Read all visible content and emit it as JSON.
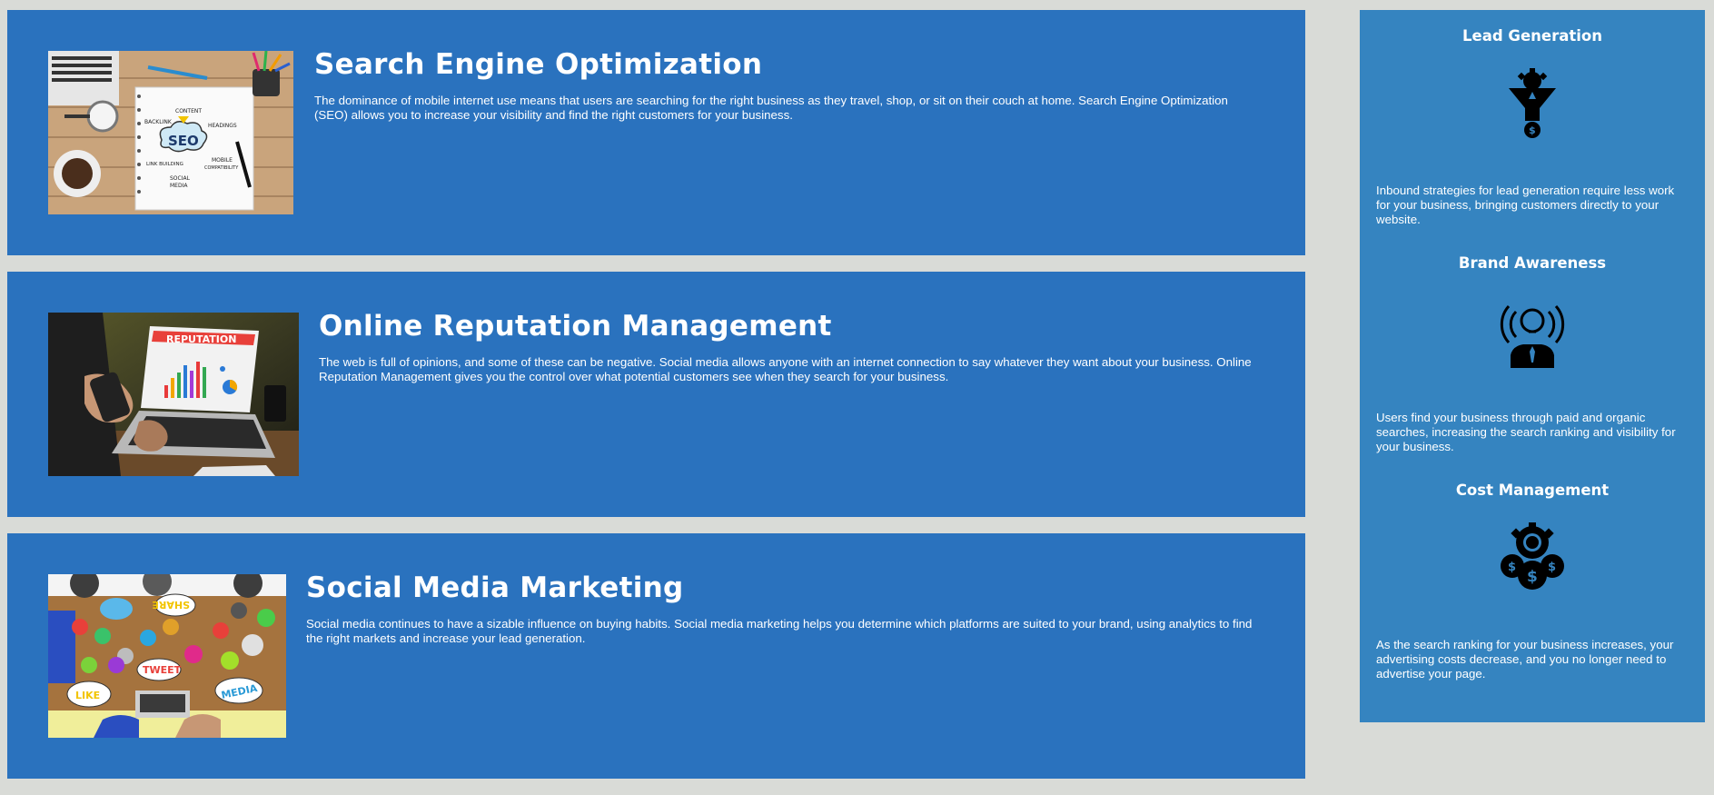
{
  "services": [
    {
      "title": "Search Engine Optimization",
      "body": "The dominance of mobile internet use means that users are searching for the right business as they travel, shop, or sit on their couch at home. Search Engine Optimization (SEO) allows you to increase your visibility and find the right customers for your business.",
      "image_labels": {
        "seo": "SEO",
        "content": "CONTENT",
        "backlink": "BACKLINK",
        "headings": "HEADINGS",
        "link_building": "LINK BUILDING",
        "mobile": "MOBILE",
        "compatibility": "COMPATIBILITY",
        "social": "SOCIAL",
        "media": "MEDIA"
      }
    },
    {
      "title": "Online Reputation Management",
      "body": "The web is full of opinions, and some of these can be negative. Social media allows anyone with an internet connection to say whatever they want about your business. Online Reputation Management gives you the control over what potential customers see when they search for your business.",
      "image_labels": {
        "banner": "REPUTATION"
      }
    },
    {
      "title": "Social Media Marketing",
      "body": "Social media continues to have a sizable influence on buying habits. Social media marketing helps you determine which platforms are suited to your brand, using analytics to find the right markets and increase your lead generation.",
      "image_labels": {
        "share": "SHARE",
        "tweet": "TWEET",
        "like": "LIKE",
        "media": "MEDIA"
      }
    }
  ],
  "benefits": [
    {
      "title": "Lead Generation",
      "body": "Inbound strategies for lead generation require less work for your business, bringing customers directly to your website.",
      "icon": "funnel-gear-icon"
    },
    {
      "title": "Brand Awareness",
      "body": "Users find your business through paid and organic searches, increasing the search ranking and visibility for your business.",
      "icon": "lightbulb-person-icon"
    },
    {
      "title": "Cost Management",
      "body": "As the search ranking for your business increases, your advertising costs decrease, and you no longer need to advertise your page.",
      "icon": "coins-gear-icon"
    }
  ],
  "colors": {
    "page_background": "#d9dbd7",
    "card_background": "#2a72be",
    "sidebar_background": "#3584c0",
    "text": "#ffffff"
  }
}
